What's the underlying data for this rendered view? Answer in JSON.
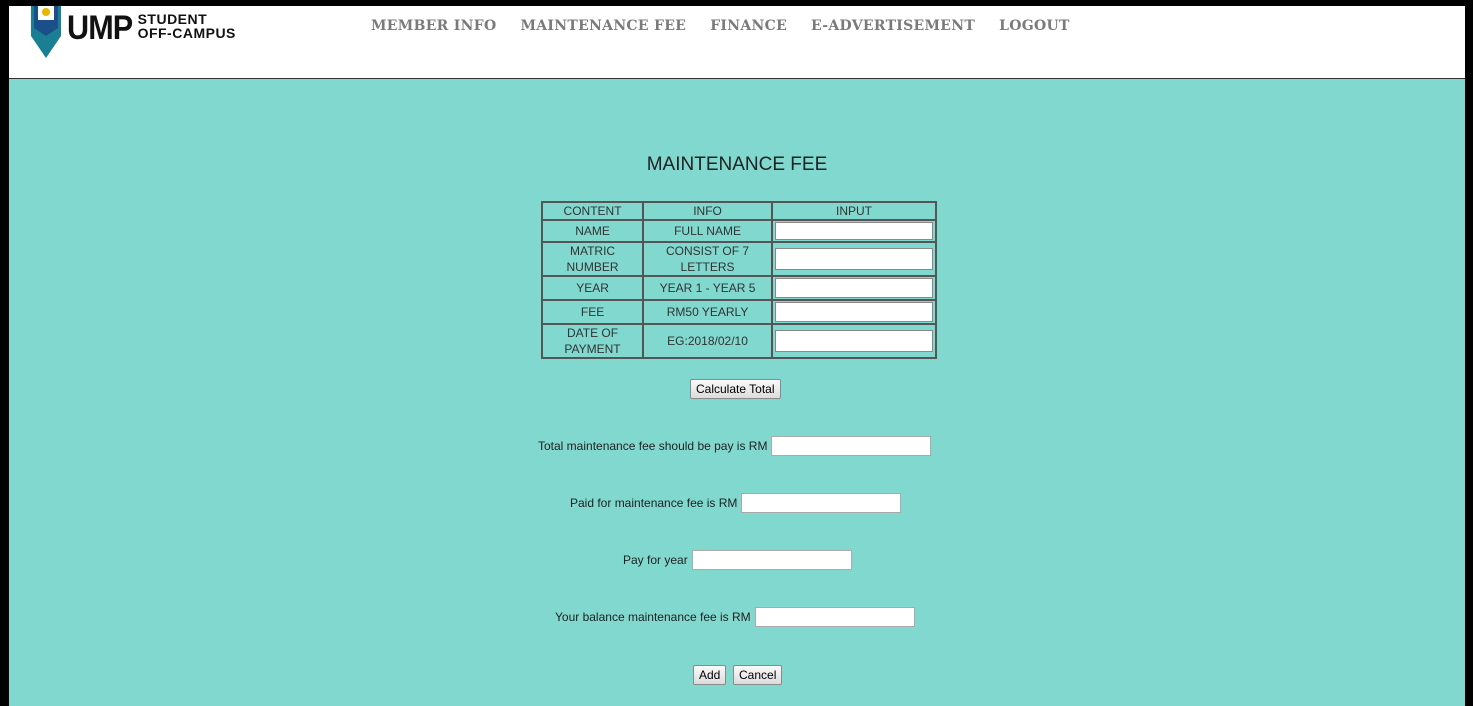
{
  "header": {
    "logo": {
      "brand": "UMP",
      "line1": "STUDENT",
      "line2": "OFF-CAMPUS"
    },
    "nav": [
      "MEMBER INFO",
      "MAINTENANCE FEE",
      "FINANCE",
      "E-ADVERTISEMENT",
      "LOGOUT"
    ]
  },
  "main": {
    "title": "MAINTENANCE FEE",
    "table": {
      "headers": [
        "CONTENT",
        "INFO",
        "INPUT"
      ],
      "rows": [
        {
          "content": "NAME",
          "info": "FULL NAME",
          "value": ""
        },
        {
          "content": "MATRIC NUMBER",
          "info": "CONSIST OF 7 LETTERS",
          "value": ""
        },
        {
          "content": "YEAR",
          "info": "YEAR 1 - YEAR 5",
          "value": ""
        },
        {
          "content": "FEE",
          "info": "RM50 YEARLY",
          "value": ""
        },
        {
          "content": "DATE OF PAYMENT",
          "info": "EG:2018/02/10",
          "value": ""
        }
      ]
    },
    "calculate_label": "Calculate Total",
    "fields": {
      "total_label": "Total maintenance fee should be pay is RM",
      "paid_label": "Paid for maintenance fee is RM",
      "year_label": "Pay for year",
      "balance_label": "Your balance maintenance fee is RM"
    },
    "add_label": "Add",
    "cancel_label": "Cancel"
  },
  "colors": {
    "background": "#80d8cf",
    "header": "#ffffff",
    "nav_text": "#7a7a7a"
  }
}
